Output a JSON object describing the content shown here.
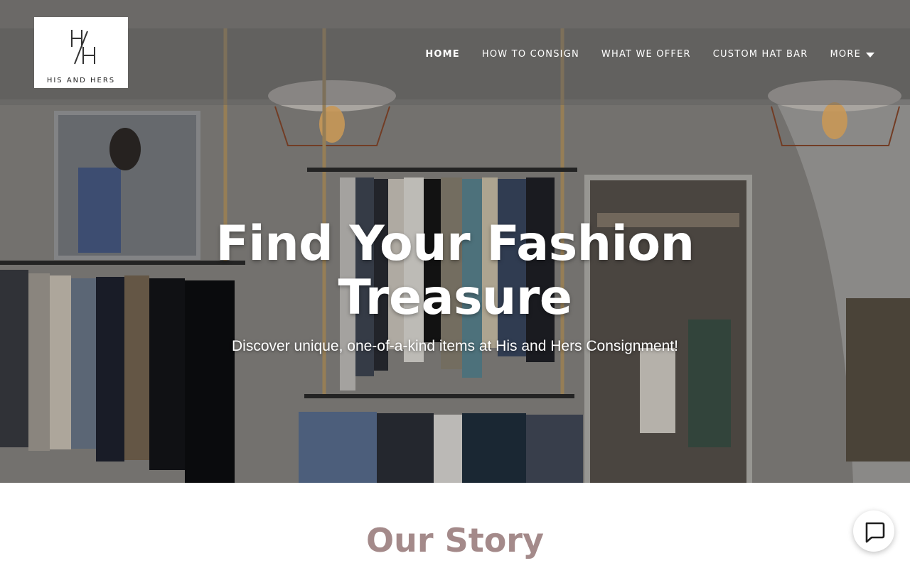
{
  "logo": {
    "text": "HIS AND HERS"
  },
  "nav": {
    "items": [
      {
        "label": "HOME",
        "active": true
      },
      {
        "label": "HOW TO CONSIGN"
      },
      {
        "label": "WHAT WE OFFER"
      },
      {
        "label": "CUSTOM HAT BAR"
      },
      {
        "label": "MORE"
      }
    ]
  },
  "hero": {
    "title": "Find Your Fashion Treasure",
    "subtitle": "Discover unique, one-of-a-kind items at His and Hers Consignment!"
  },
  "story": {
    "heading": "Our Story"
  },
  "icons": {
    "more": "caret-down-icon",
    "chat": "chat-icon"
  },
  "colors": {
    "accent": "#a48a8a",
    "header_overlay": "#5f5f5f"
  }
}
